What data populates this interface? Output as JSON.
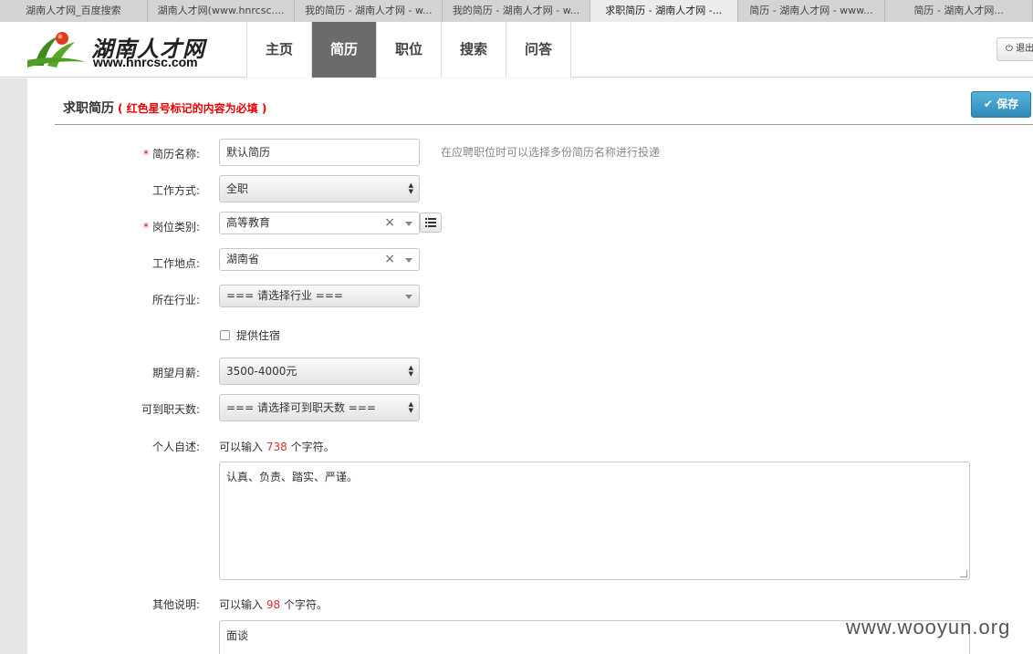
{
  "browser_tabs": [
    "湖南人才网_百度搜索",
    "湖南人才网(www.hnrcsc....",
    "我的简历 - 湖南人才网 - w...",
    "我的简历 - 湖南人才网 - w...",
    "求职简历 - 湖南人才网 -...",
    "简历 - 湖南人才网 - www...",
    "简历 - 湖南人才网..."
  ],
  "active_tab_index": 4,
  "site": {
    "logo_cn": "湖南人才网",
    "logo_url": "www.hnrcsc.com"
  },
  "nav": {
    "items": [
      "主页",
      "简历",
      "职位",
      "搜索",
      "问答"
    ],
    "active": "简历",
    "logout_label": "退出"
  },
  "page": {
    "title": "求职简历",
    "required_note": "( 红色星号标记的内容为必填 )",
    "save_label": "保存"
  },
  "form": {
    "resume_name": {
      "label": "简历名称:",
      "required": true,
      "value": "默认简历",
      "hint": "在应聘职位时可以选择多份简历名称进行投递"
    },
    "work_type": {
      "label": "工作方式:",
      "value": "全职"
    },
    "job_category": {
      "label": "岗位类别:",
      "required": true,
      "value": "高等教育"
    },
    "work_location": {
      "label": "工作地点:",
      "value": "湖南省"
    },
    "industry": {
      "label": "所在行业:",
      "value": "=== 请选择行业 ==="
    },
    "housing": {
      "label": "提供住宿",
      "checked": false
    },
    "salary": {
      "label": "期望月薪:",
      "value": "3500-4000元"
    },
    "start_days": {
      "label": "可到职天数:",
      "value": "=== 请选择可到职天数 ==="
    },
    "self_description": {
      "label": "个人自述:",
      "counter_prefix": "可以输入",
      "counter_value": "738",
      "counter_suffix": "个字符。",
      "value": "认真、负责、踏实、严谨。"
    },
    "other_notes": {
      "label": "其他说明:",
      "counter_prefix": "可以输入",
      "counter_value": "98",
      "counter_suffix": "个字符。",
      "value": "面谈"
    }
  },
  "watermark": "www.wooyun.org",
  "colors": {
    "accent": "#2f8ab8",
    "nav_active": "#6b6b6b",
    "required": "#e00000"
  }
}
